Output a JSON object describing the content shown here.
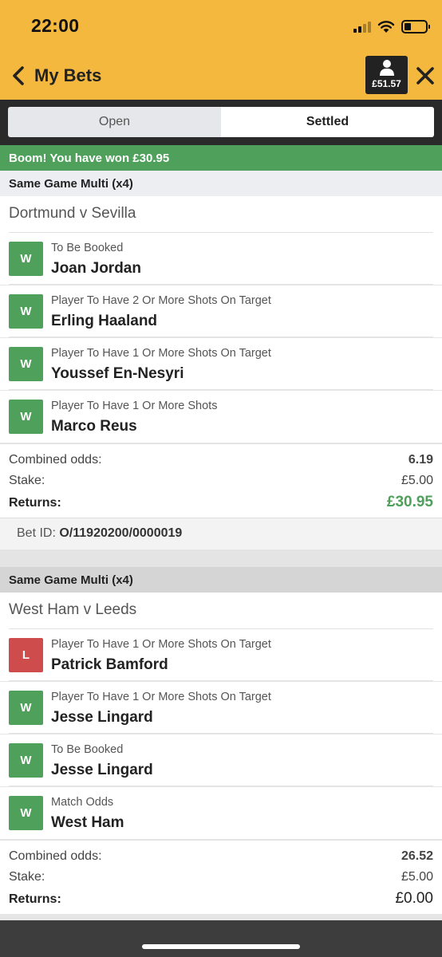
{
  "status_bar": {
    "time": "22:00"
  },
  "header": {
    "title": "My Bets",
    "balance": "£51.57"
  },
  "tabs": [
    {
      "label": "Open",
      "active": false
    },
    {
      "label": "Settled",
      "active": true
    }
  ],
  "win_banner": "Boom! You have won £30.95",
  "bets": [
    {
      "type": "Same Game Multi (x4)",
      "match": "Dortmund v Sevilla",
      "selections": [
        {
          "result": "W",
          "market": "To Be Booked",
          "player": "Joan Jordan"
        },
        {
          "result": "W",
          "market": "Player To Have 2 Or More Shots On Target",
          "player": "Erling Haaland"
        },
        {
          "result": "W",
          "market": "Player To Have 1 Or More Shots On Target",
          "player": "Youssef En-Nesyri"
        },
        {
          "result": "W",
          "market": "Player To Have 1 Or More Shots",
          "player": "Marco Reus"
        }
      ],
      "combined_odds_label": "Combined odds:",
      "combined_odds": "6.19",
      "stake_label": "Stake:",
      "stake": "£5.00",
      "returns_label": "Returns:",
      "returns": "£30.95",
      "bet_id_label": "Bet ID:",
      "bet_id": "O/11920200/0000019"
    },
    {
      "type": "Same Game Multi (x4)",
      "match": "West Ham v Leeds",
      "selections": [
        {
          "result": "L",
          "market": "Player To Have 1 Or More Shots On Target",
          "player": "Patrick Bamford"
        },
        {
          "result": "W",
          "market": "Player To Have 1 Or More Shots On Target",
          "player": "Jesse Lingard"
        },
        {
          "result": "W",
          "market": "To Be Booked",
          "player": "Jesse Lingard"
        },
        {
          "result": "W",
          "market": "Match Odds",
          "player": "West Ham"
        }
      ],
      "combined_odds_label": "Combined odds:",
      "combined_odds": "26.52",
      "stake_label": "Stake:",
      "stake": "£5.00",
      "returns_label": "Returns:",
      "returns": "£0.00"
    }
  ],
  "colors": {
    "header_bg": "#f3b83d",
    "win_green": "#4ea05a",
    "loss_red": "#cf4c4c",
    "tab_bar_bg": "#2a2a2a"
  },
  "icons": [
    "back-chevron-icon",
    "user-icon",
    "close-icon",
    "signal-icon",
    "wifi-icon",
    "battery-icon"
  ]
}
